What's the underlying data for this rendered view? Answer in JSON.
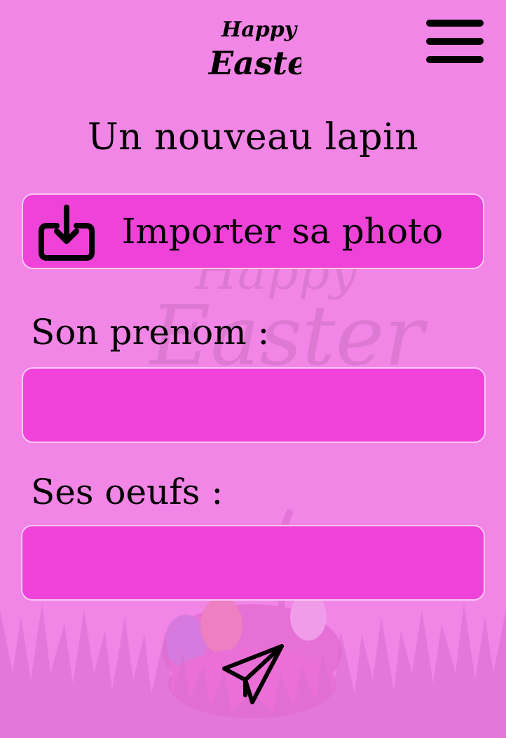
{
  "header": {
    "logo_text": "Happy Easter",
    "menu_icon": "hamburger-icon"
  },
  "form": {
    "title": "Un nouveau lapin",
    "upload": {
      "label": "Importer sa photo",
      "icon": "download-tray-icon"
    },
    "name_field": {
      "label": "Son prenom :",
      "value": "",
      "placeholder": ""
    },
    "eggs_field": {
      "label": "Ses oeufs :",
      "value": "",
      "placeholder": ""
    },
    "submit_icon": "paper-plane-icon"
  },
  "background": {
    "watermark_text": "Happy Easter",
    "decor": "easter-basket-grass"
  },
  "colors": {
    "page_background": "#f286e6",
    "field_background": "#ee42d9",
    "field_border": "#f9c8f3",
    "text": "#000000"
  }
}
